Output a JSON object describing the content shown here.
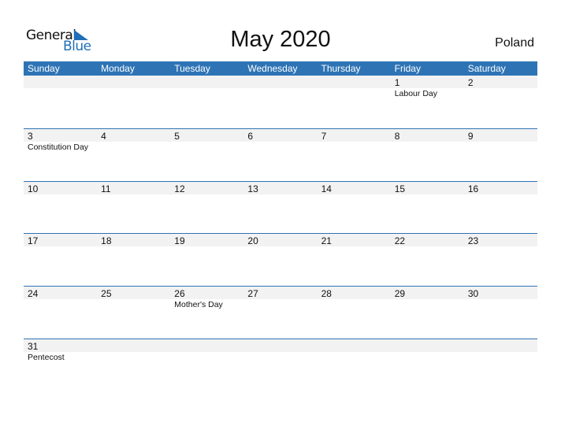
{
  "logo": {
    "general": "General",
    "blue": "Blue"
  },
  "title": "May 2020",
  "country": "Poland",
  "colors": {
    "accent": "#2e74b5",
    "strip": "#f2f2f2"
  },
  "weekdays": [
    "Sunday",
    "Monday",
    "Tuesday",
    "Wednesday",
    "Thursday",
    "Friday",
    "Saturday"
  ],
  "weeks": [
    [
      {
        "day": "",
        "holiday": ""
      },
      {
        "day": "",
        "holiday": ""
      },
      {
        "day": "",
        "holiday": ""
      },
      {
        "day": "",
        "holiday": ""
      },
      {
        "day": "",
        "holiday": ""
      },
      {
        "day": "1",
        "holiday": "Labour Day"
      },
      {
        "day": "2",
        "holiday": ""
      }
    ],
    [
      {
        "day": "3",
        "holiday": "Constitution Day"
      },
      {
        "day": "4",
        "holiday": ""
      },
      {
        "day": "5",
        "holiday": ""
      },
      {
        "day": "6",
        "holiday": ""
      },
      {
        "day": "7",
        "holiday": ""
      },
      {
        "day": "8",
        "holiday": ""
      },
      {
        "day": "9",
        "holiday": ""
      }
    ],
    [
      {
        "day": "10",
        "holiday": ""
      },
      {
        "day": "11",
        "holiday": ""
      },
      {
        "day": "12",
        "holiday": ""
      },
      {
        "day": "13",
        "holiday": ""
      },
      {
        "day": "14",
        "holiday": ""
      },
      {
        "day": "15",
        "holiday": ""
      },
      {
        "day": "16",
        "holiday": ""
      }
    ],
    [
      {
        "day": "17",
        "holiday": ""
      },
      {
        "day": "18",
        "holiday": ""
      },
      {
        "day": "19",
        "holiday": ""
      },
      {
        "day": "20",
        "holiday": ""
      },
      {
        "day": "21",
        "holiday": ""
      },
      {
        "day": "22",
        "holiday": ""
      },
      {
        "day": "23",
        "holiday": ""
      }
    ],
    [
      {
        "day": "24",
        "holiday": ""
      },
      {
        "day": "25",
        "holiday": ""
      },
      {
        "day": "26",
        "holiday": "Mother's Day"
      },
      {
        "day": "27",
        "holiday": ""
      },
      {
        "day": "28",
        "holiday": ""
      },
      {
        "day": "29",
        "holiday": ""
      },
      {
        "day": "30",
        "holiday": ""
      }
    ],
    [
      {
        "day": "31",
        "holiday": "Pentecost"
      },
      {
        "day": "",
        "holiday": ""
      },
      {
        "day": "",
        "holiday": ""
      },
      {
        "day": "",
        "holiday": ""
      },
      {
        "day": "",
        "holiday": ""
      },
      {
        "day": "",
        "holiday": ""
      },
      {
        "day": "",
        "holiday": ""
      }
    ]
  ]
}
